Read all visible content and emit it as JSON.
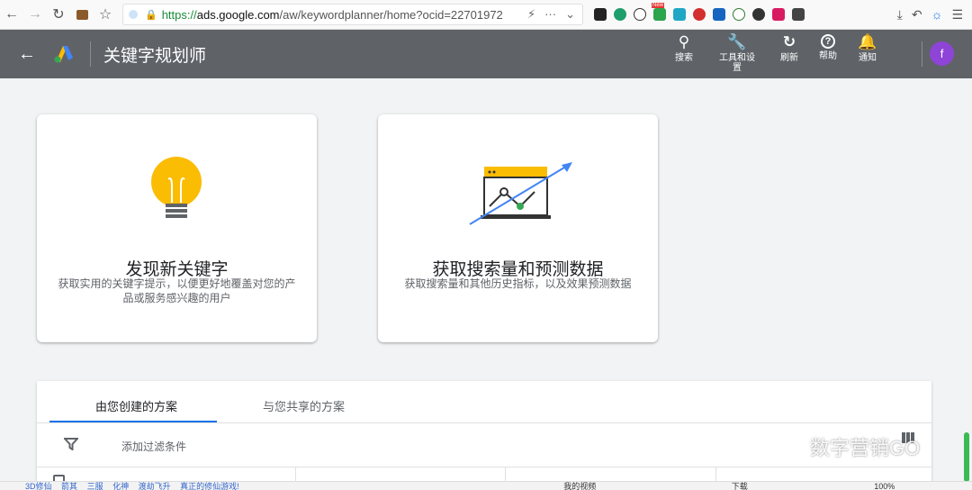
{
  "browser": {
    "url_green": "https://",
    "url_host": "ads.google.com",
    "url_path": "/aw/keywordplanner/home?ocid=22701972",
    "nav_icons": [
      "back-icon",
      "forward-icon",
      "reload-icon",
      "briefcase-icon",
      "star-icon"
    ],
    "badge_new": "New"
  },
  "header": {
    "title": "关键字规划师",
    "tools": [
      {
        "icon": "search-icon",
        "label": "搜索"
      },
      {
        "icon": "wrench-icon",
        "label": "工具和设置"
      },
      {
        "icon": "refresh-icon",
        "label": "刷新"
      },
      {
        "icon": "help-icon",
        "label": "帮助"
      },
      {
        "icon": "bell-icon",
        "label": "通知"
      }
    ],
    "avatar_letter": "f",
    "avatar_color": "#8e44d6"
  },
  "cards": [
    {
      "title": "发现新关键字",
      "description": "获取实用的关键字提示，以便更好地覆盖对您的产品或服务感兴趣的用户",
      "icon": "lightbulb-icon"
    },
    {
      "title": "获取搜索量和预测数据",
      "description": "获取搜索量和其他历史指标，以及效果预测数据",
      "icon": "chart-trend-icon"
    }
  ],
  "plans": {
    "tabs": [
      "由您创建的方案",
      "与您共享的方案"
    ],
    "active_tab": 0,
    "filter_placeholder": "添加过滤条件"
  },
  "watermark": "数字营销GO",
  "status_bar": {
    "items": [
      "3D修仙",
      "箭其",
      "三服",
      "化神",
      "渡劫飞升",
      "真正的修仙游戏!"
    ],
    "right_items": [
      "我的视频",
      "下载",
      "100%"
    ]
  },
  "colors": {
    "header_bg": "#5f6368",
    "accent": "#1a73e8",
    "bulb": "#fbbc04"
  }
}
